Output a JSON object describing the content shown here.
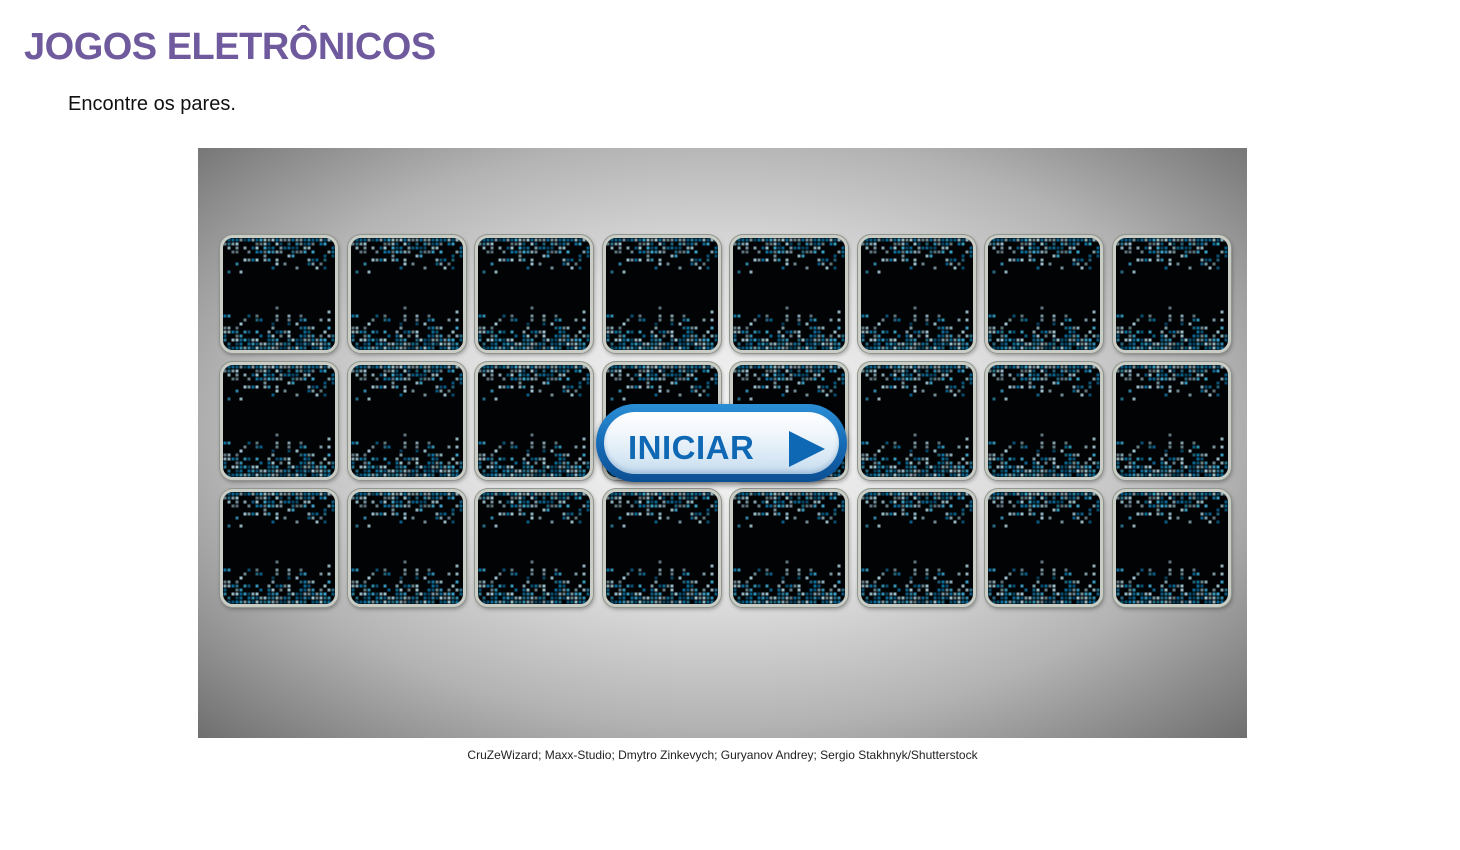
{
  "title": "JOGOS ELETRÔNICOS",
  "instruction": "Encontre os pares.",
  "game": {
    "rows": 3,
    "columns": 8,
    "card_back": "pixel-mosaic-blue",
    "start_button_label": "INICIAR",
    "start_button_icon": "play-icon"
  },
  "credits": "CruZeWizard; Maxx-Studio; Dmytro Zinkevych; Guryanov Andrey; Sergio Stakhnyk/Shutterstock",
  "colors": {
    "title": "#6f5a9e",
    "button": "#0f68b3",
    "card_pixel_light": "#9ec3cf",
    "card_pixel_dark": "#0b6e9c"
  }
}
